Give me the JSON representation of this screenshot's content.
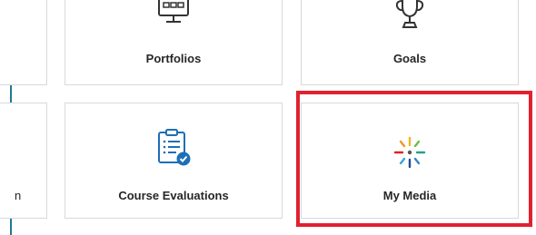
{
  "tiles": {
    "portfolios": {
      "label": "Portfolios",
      "icon": "portfolio-presentation-icon"
    },
    "goals": {
      "label": "Goals",
      "icon": "trophy-icon"
    },
    "partial_left": {
      "label_fragment": "n"
    },
    "course_evaluations": {
      "label": "Course Evaluations",
      "icon": "clipboard-check-icon"
    },
    "my_media": {
      "label": "My Media",
      "icon": "kaltura-burst-icon"
    }
  },
  "colors": {
    "highlight": "#e0212f",
    "left_rule": "#1f7a8f",
    "tile_border": "#d6d9dc",
    "icon_blue": "#1d6fb7"
  }
}
